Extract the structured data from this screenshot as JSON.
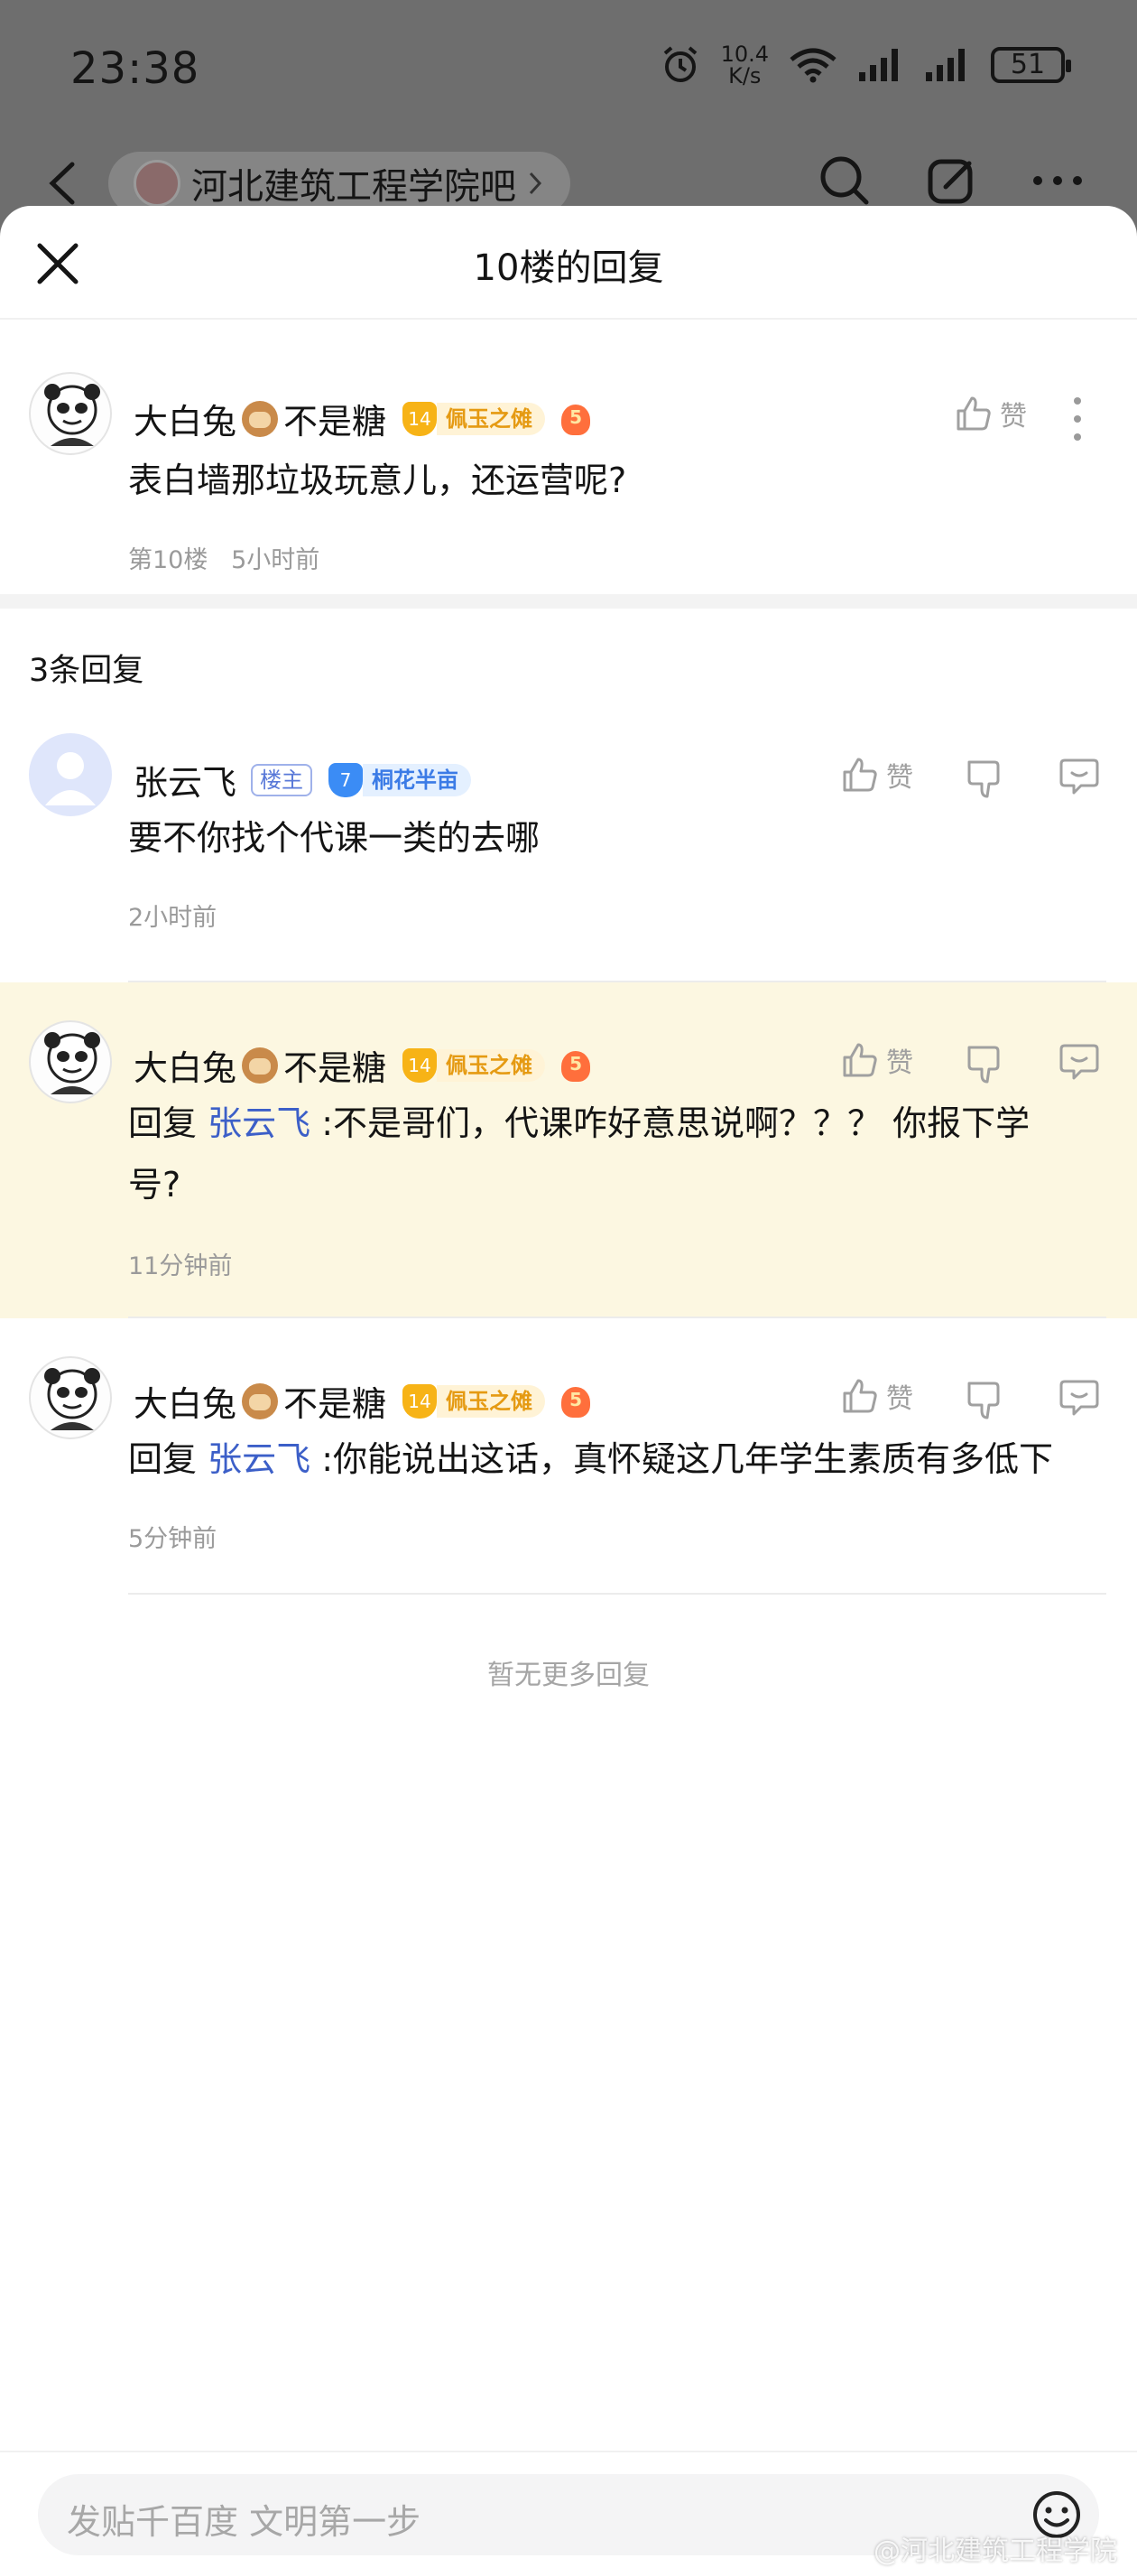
{
  "status_bar": {
    "time": "23:38",
    "net_speed_value": "10.4",
    "net_speed_unit": "K/s",
    "battery": "51"
  },
  "top_nav": {
    "forum_name": "河北建筑工程学院吧"
  },
  "sheet": {
    "title": "10楼的回复"
  },
  "origin_post": {
    "username": "大白兔",
    "username_suffix": "不是糖",
    "level": "14",
    "level_title": "佩玉之傩",
    "like_label": "赞",
    "content": "表白墙那垃圾玩意儿，还运营呢?",
    "floor": "第10楼",
    "time": "5小时前"
  },
  "reply_count": "3条回复",
  "replies": [
    {
      "username": "张云飞",
      "owner_tag": "楼主",
      "level": "7",
      "level_title": "桐花半亩",
      "like_label": "赞",
      "content": "要不你找个代课一类的去哪",
      "time": "2小时前"
    },
    {
      "username": "大白兔",
      "username_suffix": "不是糖",
      "level": "14",
      "level_title": "佩玉之傩",
      "like_label": "赞",
      "reply_prefix": "回复",
      "reply_target": "张云飞",
      "content_line1": ":不是哥们，代课咋好意思说啊？？？ 你报下学",
      "content_line2": "号?",
      "time": "11分钟前"
    },
    {
      "username": "大白兔",
      "username_suffix": "不是糖",
      "level": "14",
      "level_title": "佩玉之傩",
      "like_label": "赞",
      "reply_prefix": "回复",
      "reply_target": "张云飞",
      "content_line1": ":你能说出这话，真怀疑这几年学生素质有多低下",
      "time": "5分钟前"
    }
  ],
  "no_more": "暂无更多回复",
  "bottom": {
    "placeholder": "发贴千百度 文明第一步"
  },
  "watermark": "@河北建筑工程学院",
  "colors": {
    "highlight_bg": "#fcf7e1",
    "link": "#3c5fc8",
    "badge_gold": "#f7b316",
    "badge_blue": "#3b8cf5"
  }
}
